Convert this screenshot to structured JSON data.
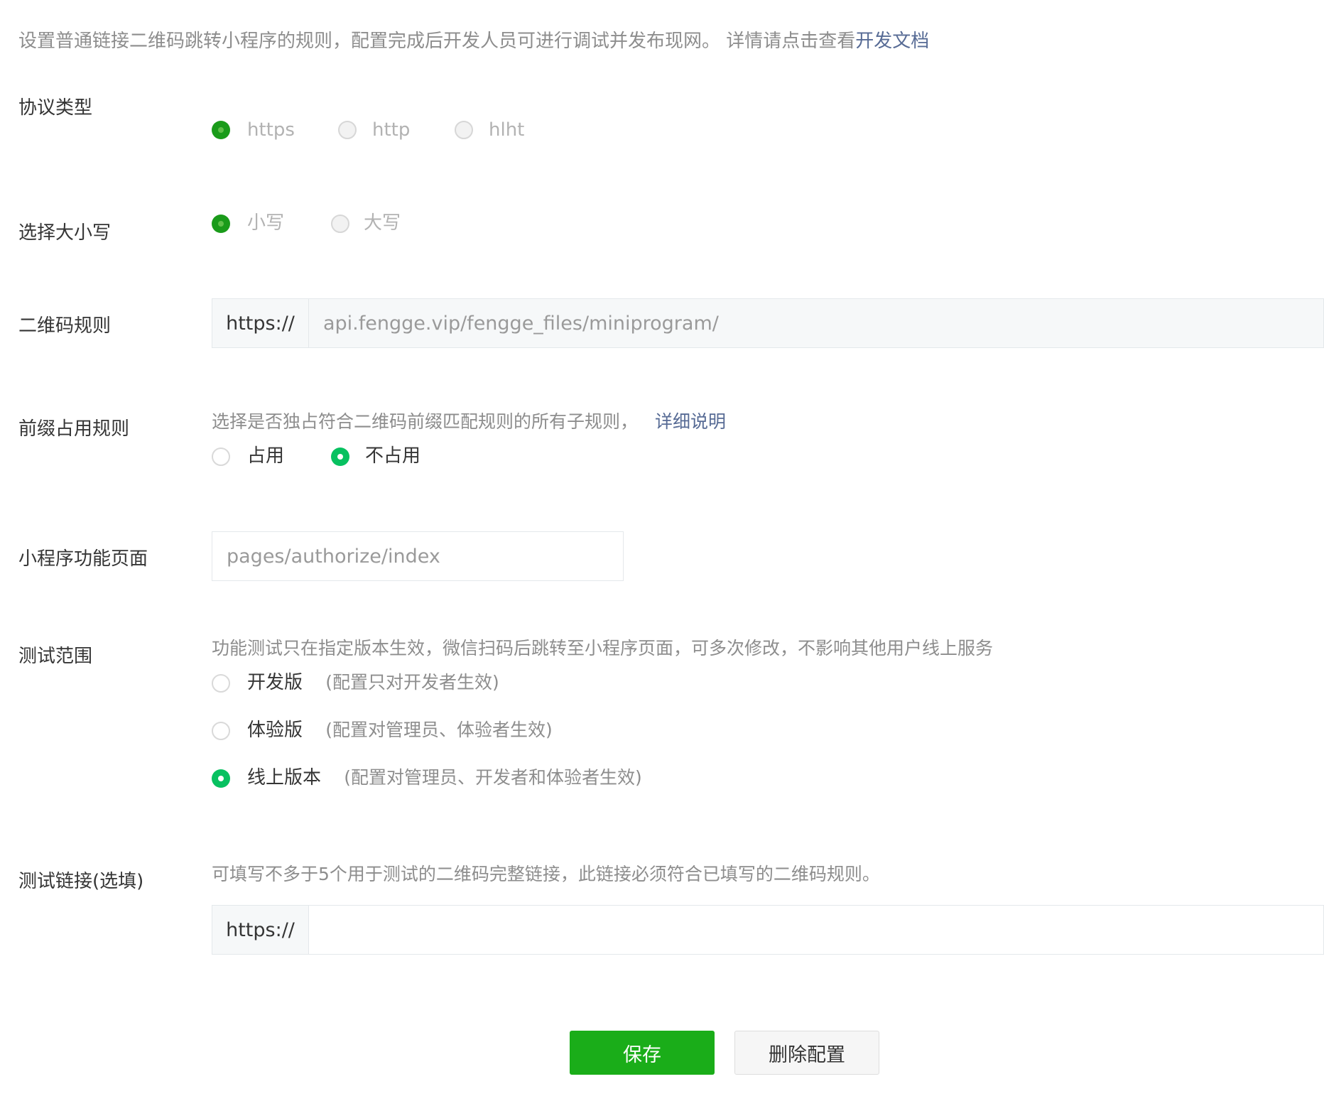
{
  "colors": {
    "primary_green": "#1aad19",
    "radio_on": "#07c160",
    "radio_on_disabled": "#1a9b1a",
    "link": "#576b95"
  },
  "intro": {
    "text": "设置普通链接二维码跳转小程序的规则，配置完成后开发人员可进行调试并发布现网。 详情请点击查看",
    "link": "开发文档"
  },
  "protocol": {
    "label": "协议类型",
    "options": [
      "https",
      "http",
      "hlht"
    ],
    "selected": "https"
  },
  "case": {
    "label": "选择大小写",
    "options": [
      "小写",
      "大写"
    ],
    "selected": "小写"
  },
  "qr_rule": {
    "label": "二维码规则",
    "prefix": "https://",
    "value": "api.fengge.vip/fengge_files/miniprogram/"
  },
  "prefix_rule": {
    "label": "前缀占用规则",
    "hint": "选择是否独占符合二维码前缀匹配规则的所有子规则，",
    "hint_link": "详细说明",
    "options": [
      "占用",
      "不占用"
    ],
    "selected": "不占用"
  },
  "page": {
    "label": "小程序功能页面",
    "value": "pages/authorize/index"
  },
  "test_scope": {
    "label": "测试范围",
    "hint": "功能测试只在指定版本生效，微信扫码后跳转至小程序页面，可多次修改，不影响其他用户线上服务",
    "options": [
      {
        "name": "开发版",
        "desc": "(配置只对开发者生效)"
      },
      {
        "name": "体验版",
        "desc": "(配置对管理员、体验者生效)"
      },
      {
        "name": "线上版本",
        "desc": "(配置对管理员、开发者和体验者生效)"
      }
    ],
    "selected": "线上版本"
  },
  "test_link": {
    "label": "测试链接(选填)",
    "hint": "可填写不多于5个用于测试的二维码完整链接，此链接必须符合已填写的二维码规则。",
    "prefix": "https://",
    "value": ""
  },
  "actions": {
    "save": "保存",
    "delete": "删除配置"
  }
}
